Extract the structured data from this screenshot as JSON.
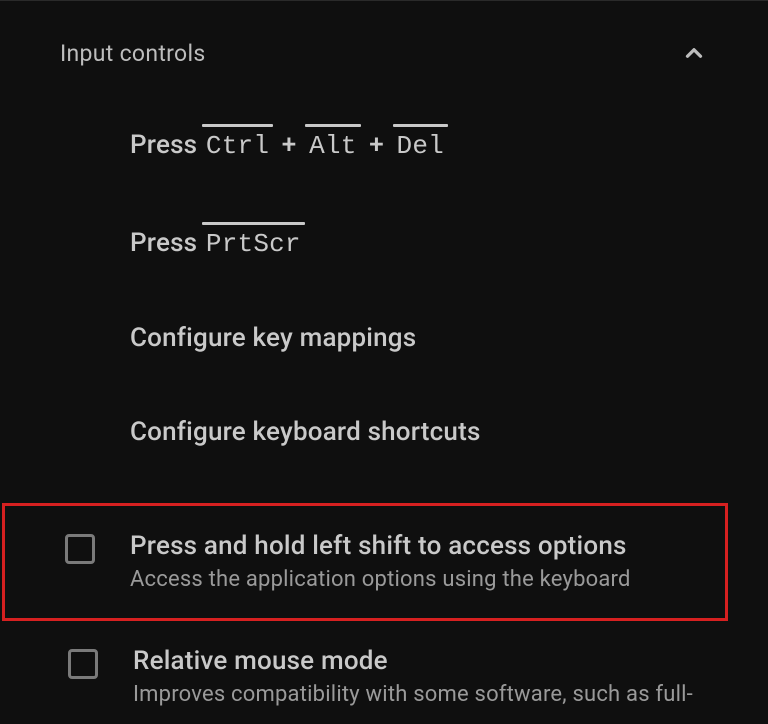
{
  "section": {
    "title": "Input controls"
  },
  "items": {
    "press1": {
      "prefix": "Press",
      "keys": [
        "Ctrl",
        "Alt",
        "Del"
      ],
      "plus": "+"
    },
    "press2": {
      "prefix": "Press",
      "keys": [
        "PrtScr"
      ]
    },
    "mappings": {
      "label": "Configure key mappings"
    },
    "shortcuts": {
      "label": "Configure keyboard shortcuts"
    }
  },
  "checks": {
    "shift": {
      "title": "Press and hold left shift to access options",
      "desc": "Access the application options using the keyboard"
    },
    "mouse": {
      "title": "Relative mouse mode",
      "desc": "Improves compatibility with some software, such as full-"
    }
  }
}
